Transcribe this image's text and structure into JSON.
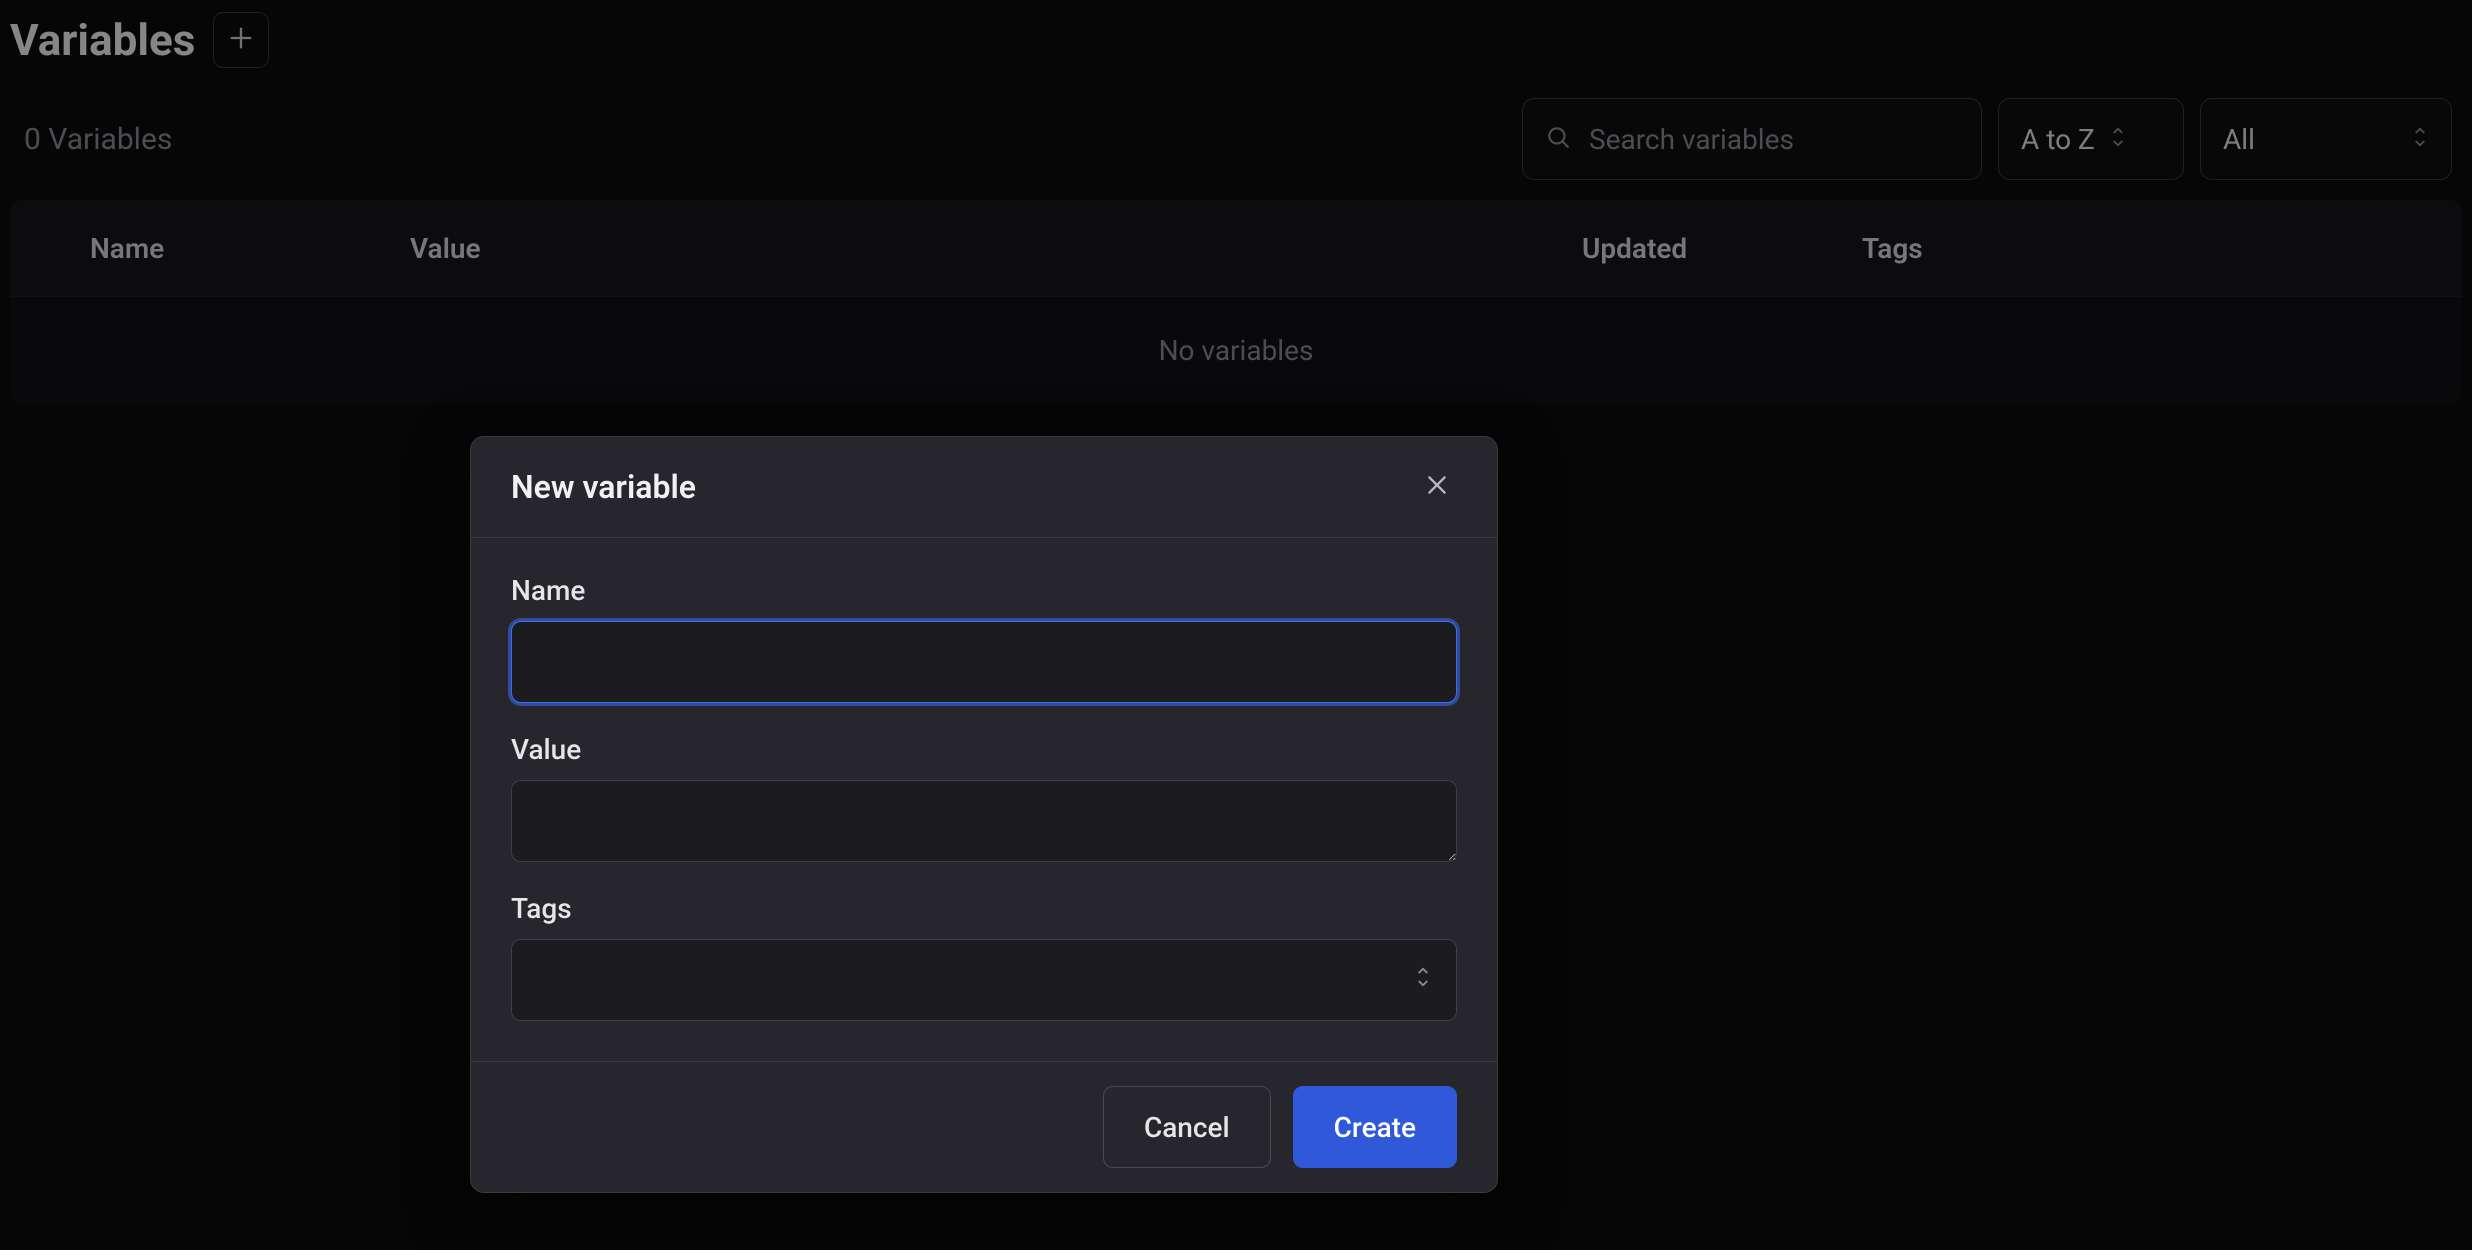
{
  "header": {
    "title": "Variables"
  },
  "toolbar": {
    "count_text": "0 Variables",
    "search_placeholder": "Search variables",
    "sort_label": "A to Z",
    "filter_label": "All"
  },
  "table": {
    "columns": {
      "name": "Name",
      "value": "Value",
      "updated": "Updated",
      "tags": "Tags"
    },
    "empty_text": "No variables"
  },
  "modal": {
    "title": "New variable",
    "fields": {
      "name_label": "Name",
      "name_value": "",
      "value_label": "Value",
      "value_value": "",
      "tags_label": "Tags",
      "tags_value": ""
    },
    "buttons": {
      "cancel": "Cancel",
      "create": "Create"
    }
  }
}
